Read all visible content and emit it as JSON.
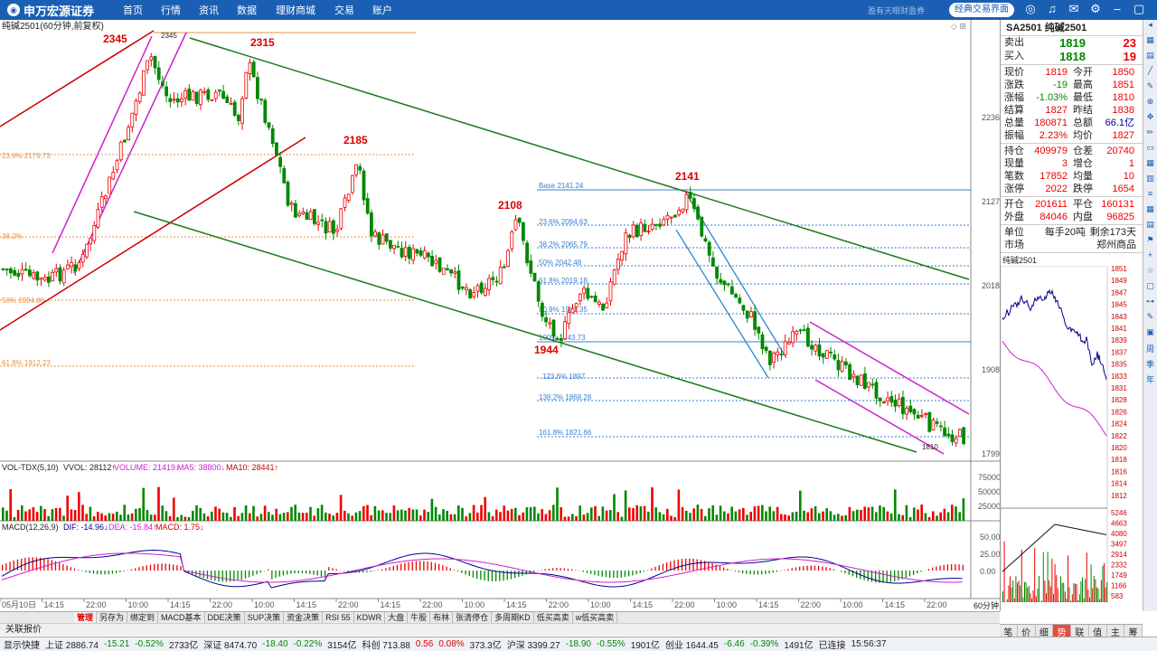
{
  "topbar": {
    "logo": "申万宏源证券",
    "nav": [
      "首页",
      "行情",
      "资讯",
      "数据",
      "理财商城",
      "交易",
      "账户"
    ],
    "slogan": "盈有天眼财盈券",
    "classic_button": "经典交易界面"
  },
  "chart": {
    "header": "纯碱2501(60分钟,前复权)",
    "peaks": {
      "p2345": "2345",
      "p2345b": "2345",
      "p2315": "2315",
      "p2185": "2185",
      "p2141": "2141",
      "p2108": "2108",
      "p1944": "1944",
      "p1810": "1810"
    },
    "y_ticks": [
      "2236",
      "2127",
      "2018",
      "1908",
      "1799"
    ],
    "fib_left": [
      "23.6% 2179.73",
      "38.2%",
      "50% 1994.86",
      "61.8% 1912.23"
    ],
    "fib_right": [
      "Base 2141.24",
      "23.6% 2094.63",
      "38.2% 2065.79",
      "50% 2042.48",
      "61.8% 2019.18",
      "80.9% 1981.35",
      "100% 1943.73",
      "123.6% 1897",
      "138.2% 1868.28",
      "161.8% 1821.66"
    ],
    "vol_header": {
      "title": "VOL-TDX(5,10)",
      "vol": "VVOL: 28112↑",
      "volume": "VOLUME: 21419↓",
      "ma5": "MA5: 38800↓",
      "ma10": "MA10: 28441↑"
    },
    "vol_ticks": [
      "75000",
      "50000",
      "25000"
    ],
    "macd_header": {
      "title": "MACD(12,26,9)",
      "dif": "DIF: -14.96↓",
      "dea": "DEA: -15.84↑",
      "macd": "MACD: 1.75↓"
    },
    "macd_ticks": [
      "50.00",
      "25.00",
      "0.00"
    ],
    "x_ticks": [
      "05月10日",
      "14:15",
      "22:00",
      "10:00",
      "14:15",
      "22:00",
      "10:00",
      "14:15",
      "22:00",
      "14:15",
      "22:00",
      "10:00",
      "14:15",
      "22:00",
      "10:00",
      "14:15",
      "22:00",
      "10:00",
      "14:15",
      "22:00",
      "10:00",
      "14:15",
      "22:00"
    ],
    "period": "60分钟"
  },
  "quote": {
    "title": "SA2501 纯碱2501",
    "sell": {
      "label": "卖出",
      "price": "1819",
      "qty": "23"
    },
    "buy": {
      "label": "买入",
      "price": "1818",
      "qty": "19"
    },
    "rows": [
      [
        "现价",
        "1819",
        "今开",
        "1850"
      ],
      [
        "涨跌",
        "-19",
        "最高",
        "1851"
      ],
      [
        "涨幅",
        "-1.03%",
        "最低",
        "1810"
      ],
      [
        "结算",
        "1827",
        "昨结",
        "1838"
      ],
      [
        "总量",
        "180871",
        "总额",
        "66.1亿"
      ],
      [
        "振幅",
        "2.23%",
        "均价",
        "1827"
      ]
    ],
    "rows2": [
      [
        "持仓",
        "409979",
        "仓差",
        "20740"
      ],
      [
        "现量",
        "3",
        "增仓",
        "1"
      ],
      [
        "笔数",
        "17852",
        "均量",
        "10"
      ],
      [
        "涨停",
        "2022",
        "跌停",
        "1654"
      ]
    ],
    "rows3": [
      [
        "开仓",
        "201611",
        "平仓",
        "160131"
      ],
      [
        "外盘",
        "84046",
        "内盘",
        "96825"
      ]
    ],
    "unit_label": "单位",
    "unit_value": "每手20吨",
    "remain": "剩余173天",
    "market_label": "市场",
    "market_value": "郑州商品",
    "mini_title": "纯碱2501",
    "mini_price_ticks": [
      "1851",
      "1849",
      "1847",
      "1845",
      "1843",
      "1841",
      "1839",
      "1837",
      "1835",
      "1833",
      "1831",
      "1828",
      "1826",
      "1824",
      "1822",
      "1820",
      "1818",
      "1816",
      "1814",
      "1812"
    ],
    "mini_vol_ticks": [
      "5246",
      "4663",
      "4080",
      "3497",
      "2914",
      "2332",
      "1749",
      "1166",
      "583"
    ]
  },
  "bottom_tabs": [
    "管理",
    "另存为",
    "绑定到",
    "MACD基本",
    "DDE决策",
    "SUP决策",
    "资金决策",
    "RSI 55",
    "KDWR",
    "大盘",
    "牛股",
    "布林",
    "张清停仓",
    "多周期KD",
    "低买高卖",
    "w低买高卖"
  ],
  "right_tabs": [
    "笔",
    "价",
    "细",
    "势",
    "联",
    "值",
    "主",
    "筹"
  ],
  "subbar": "关联报价",
  "status": [
    "显示快捷",
    "上证 2886.74",
    "-15.21",
    "-0.52%",
    "2733亿",
    "深证 8474.70",
    "-18.40",
    "-0.22%",
    "3154亿",
    "科创 713.88",
    "0.56",
    "0.08%",
    "373.3亿",
    "沪深 3399.27",
    "-18.90",
    "-0.55%",
    "1901亿",
    "创业 1644.45",
    "-6.46",
    "-0.39%",
    "1491亿",
    "已连接",
    "15:56:37"
  ]
}
